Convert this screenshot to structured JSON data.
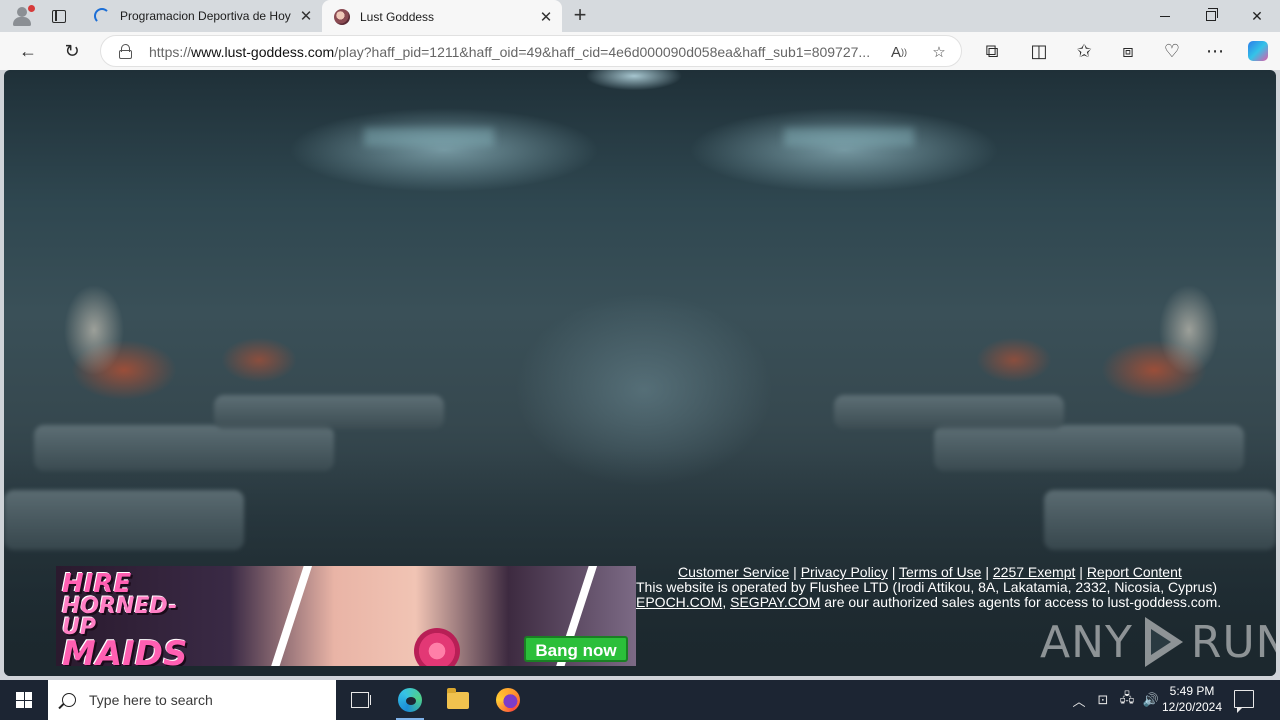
{
  "browser": {
    "tabs": [
      {
        "title": "Programacion Deportiva de Hoy",
        "active": false,
        "favicon": "loading-spinner-icon"
      },
      {
        "title": "Lust Goddess",
        "active": true,
        "favicon": "site-favicon"
      }
    ],
    "address": {
      "url_prefix": "https://",
      "url_domain": "www.lust-goddess.com",
      "url_rest": "/play?haff_pid=1211&haff_oid=49&haff_cid=4e6d000090d058ea&haff_sub1=809727..."
    }
  },
  "page": {
    "ad": {
      "line1": "HIRE",
      "line2": "HORNED-UP",
      "line3": "MAIDS",
      "cta": "Bang now"
    },
    "footer": {
      "links": [
        "Customer Service",
        "Privacy Policy",
        "Terms of Use",
        "2257 Exempt",
        "Report Content"
      ],
      "separator": " | ",
      "operator_text": "This website is operated by Flushee LTD (Irodi Attikou, 8A, Lakatamia, 2332, Nicosia, Cyprus)",
      "agent1": "EPOCH.COM",
      "agent_sep": ", ",
      "agent2": "SEGPAY.COM",
      "agents_suffix": " are our authorized sales agents for access to lust-goddess.com."
    },
    "watermark": {
      "left": "ANY",
      "right": "RUN"
    }
  },
  "taskbar": {
    "search_placeholder": "Type here to search",
    "time": "5:49 PM",
    "date": "12/20/2024"
  },
  "colors": {
    "tab_strip": "#d6dade",
    "toolbar": "#f7f7f7",
    "taskbar": "#1c2533",
    "ad_cta": "#2bbf3a"
  }
}
